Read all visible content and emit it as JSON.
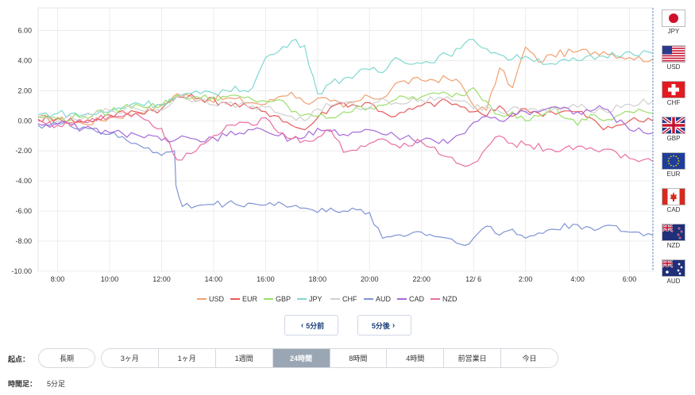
{
  "chart_data": {
    "type": "line",
    "y_ticks": [
      "6.00",
      "4.00",
      "2.00",
      "0.00",
      "-2.00",
      "-4.00",
      "-6.00",
      "-8.00",
      "-10.00"
    ],
    "ylim": [
      -10,
      7.5
    ],
    "x_ticks": [
      "8:00",
      "10:00",
      "12:00",
      "14:00",
      "16:00",
      "18:00",
      "20:00",
      "22:00",
      "12/ 6",
      "2:00",
      "4:00",
      "6:00"
    ],
    "x_tick_hours": [
      8,
      10,
      12,
      14,
      16,
      18,
      20,
      22,
      24,
      26,
      28,
      30
    ],
    "xlim": [
      7.25,
      30.9
    ],
    "grid": true,
    "legend_position": "bottom",
    "series": [
      {
        "name": "USD",
        "color": "#f0a070",
        "points": [
          [
            7.25,
            0.2
          ],
          [
            8,
            0.1
          ],
          [
            9,
            -0.2
          ],
          [
            10,
            0.2
          ],
          [
            11,
            0.5
          ],
          [
            12,
            1.0
          ],
          [
            12.6,
            1.8
          ],
          [
            13.5,
            1.4
          ],
          [
            14.5,
            1.5
          ],
          [
            15.5,
            1.2
          ],
          [
            16,
            1.1
          ],
          [
            16.5,
            1.6
          ],
          [
            17,
            1.9
          ],
          [
            17.5,
            1.2
          ],
          [
            18,
            1.5
          ],
          [
            18.5,
            1.3
          ],
          [
            19,
            0.9
          ],
          [
            20,
            1.6
          ],
          [
            20.5,
            1.5
          ],
          [
            21,
            2.5
          ],
          [
            22,
            2.7
          ],
          [
            23,
            2.8
          ],
          [
            23.5,
            2.5
          ],
          [
            24,
            1.0
          ],
          [
            24.5,
            0.7
          ],
          [
            25,
            3.5
          ],
          [
            25.5,
            2.2
          ],
          [
            26,
            4.9
          ],
          [
            26.5,
            3.9
          ],
          [
            27,
            4.4
          ],
          [
            28,
            4.6
          ],
          [
            29,
            4.6
          ],
          [
            30,
            4.2
          ],
          [
            30.9,
            4.1
          ]
        ]
      },
      {
        "name": "EUR",
        "color": "#e85a5a",
        "points": [
          [
            7.25,
            0.1
          ],
          [
            8,
            0.2
          ],
          [
            9,
            -0.1
          ],
          [
            10,
            0.4
          ],
          [
            11,
            0.6
          ],
          [
            12,
            0.8
          ],
          [
            12.6,
            1.6
          ],
          [
            13.5,
            1.5
          ],
          [
            14.5,
            1.2
          ],
          [
            15.5,
            0.8
          ],
          [
            16,
            0.6
          ],
          [
            16.5,
            0.3
          ],
          [
            17,
            -0.3
          ],
          [
            17.5,
            -0.6
          ],
          [
            18,
            0.2
          ],
          [
            18.5,
            0.9
          ],
          [
            19,
            1.2
          ],
          [
            19.5,
            1.0
          ],
          [
            20,
            1.2
          ],
          [
            20.5,
            0.6
          ],
          [
            21,
            0.3
          ],
          [
            22,
            1.0
          ],
          [
            23,
            1.3
          ],
          [
            24,
            0.6
          ],
          [
            24.5,
            0.3
          ],
          [
            25,
            1.0
          ],
          [
            25.5,
            0.3
          ],
          [
            26,
            0.8
          ],
          [
            26.5,
            0.5
          ],
          [
            27,
            0.6
          ],
          [
            28,
            0.6
          ],
          [
            28.5,
            0.2
          ],
          [
            29,
            -0.6
          ],
          [
            29.5,
            -0.3
          ],
          [
            30,
            0.0
          ],
          [
            30.9,
            0.0
          ]
        ]
      },
      {
        "name": "GBP",
        "color": "#9be06b",
        "points": [
          [
            7.25,
            0.3
          ],
          [
            8,
            0.1
          ],
          [
            9,
            0.3
          ],
          [
            10,
            0.6
          ],
          [
            11,
            1.1
          ],
          [
            12,
            1.0
          ],
          [
            12.6,
            1.7
          ],
          [
            13.5,
            1.5
          ],
          [
            14.5,
            1.6
          ],
          [
            15.5,
            1.4
          ],
          [
            16,
            1.3
          ],
          [
            16.5,
            1.4
          ],
          [
            17,
            0.6
          ],
          [
            17.5,
            0.4
          ],
          [
            18,
            0.3
          ],
          [
            18.5,
            0.2
          ],
          [
            19,
            0.6
          ],
          [
            20,
            0.9
          ],
          [
            21,
            1.4
          ],
          [
            22,
            1.6
          ],
          [
            23,
            1.8
          ],
          [
            23.5,
            1.7
          ],
          [
            24,
            2.2
          ],
          [
            24.5,
            1.3
          ],
          [
            25,
            0.4
          ],
          [
            25.5,
            0.6
          ],
          [
            26,
            0.0
          ],
          [
            26.5,
            0.3
          ],
          [
            27,
            0.9
          ],
          [
            28,
            -0.3
          ],
          [
            28.5,
            0.4
          ],
          [
            29,
            0.0
          ],
          [
            30,
            0.6
          ],
          [
            30.9,
            0.5
          ]
        ]
      },
      {
        "name": "JPY",
        "color": "#7fd8d0",
        "points": [
          [
            7.25,
            0.4
          ],
          [
            8,
            0.5
          ],
          [
            9,
            0.4
          ],
          [
            10,
            0.6
          ],
          [
            11,
            1.2
          ],
          [
            12,
            1.1
          ],
          [
            12.6,
            1.6
          ],
          [
            13.5,
            1.8
          ],
          [
            14.5,
            2.0
          ],
          [
            15.5,
            2.2
          ],
          [
            16,
            4.2
          ],
          [
            16.5,
            4.6
          ],
          [
            17,
            5.3
          ],
          [
            17.5,
            5.0
          ],
          [
            18,
            1.8
          ],
          [
            18.5,
            2.5
          ],
          [
            19,
            2.8
          ],
          [
            20,
            3.4
          ],
          [
            20.5,
            3.2
          ],
          [
            21,
            4.2
          ],
          [
            22,
            3.8
          ],
          [
            23,
            4.4
          ],
          [
            23.5,
            4.8
          ],
          [
            24,
            5.4
          ],
          [
            24.5,
            4.8
          ],
          [
            25,
            4.4
          ],
          [
            25.5,
            4.1
          ],
          [
            26,
            4.3
          ],
          [
            27,
            3.8
          ],
          [
            28,
            4.0
          ],
          [
            29,
            4.3
          ],
          [
            30,
            4.6
          ],
          [
            30.9,
            4.5
          ]
        ]
      },
      {
        "name": "CHF",
        "color": "#d0d0d0",
        "points": [
          [
            7.25,
            0.2
          ],
          [
            8,
            0.0
          ],
          [
            9,
            0.2
          ],
          [
            10,
            0.7
          ],
          [
            11,
            0.8
          ],
          [
            12,
            0.7
          ],
          [
            12.6,
            1.6
          ],
          [
            13.5,
            1.4
          ],
          [
            14.5,
            1.1
          ],
          [
            15.5,
            1.0
          ],
          [
            16,
            0.9
          ],
          [
            16.5,
            0.5
          ],
          [
            17,
            0.3
          ],
          [
            17.5,
            0.0
          ],
          [
            18,
            0.8
          ],
          [
            18.5,
            1.0
          ],
          [
            19,
            1.2
          ],
          [
            20,
            0.8
          ],
          [
            20.5,
            1.5
          ],
          [
            21,
            1.2
          ],
          [
            22,
            1.4
          ],
          [
            23,
            1.6
          ],
          [
            23.5,
            1.3
          ],
          [
            24,
            0.8
          ],
          [
            24.5,
            1.0
          ],
          [
            25,
            0.6
          ],
          [
            25.5,
            0.9
          ],
          [
            26,
            0.6
          ],
          [
            27,
            0.7
          ],
          [
            28,
            0.9
          ],
          [
            29,
            0.7
          ],
          [
            30,
            1.1
          ],
          [
            30.9,
            1.3
          ]
        ]
      },
      {
        "name": "AUD",
        "color": "#7f94d6",
        "points": [
          [
            7.25,
            -0.3
          ],
          [
            8,
            -0.2
          ],
          [
            9,
            -0.4
          ],
          [
            10,
            -0.9
          ],
          [
            11,
            -1.5
          ],
          [
            11.5,
            -1.8
          ],
          [
            12,
            -2.3
          ],
          [
            12.5,
            -2.0
          ],
          [
            12.55,
            -4.3
          ],
          [
            12.8,
            -5.7
          ],
          [
            13.5,
            -5.6
          ],
          [
            14.5,
            -5.5
          ],
          [
            15.5,
            -5.5
          ],
          [
            16,
            -5.6
          ],
          [
            16.5,
            -5.4
          ],
          [
            17,
            -5.7
          ],
          [
            17.5,
            -5.8
          ],
          [
            18,
            -6.1
          ],
          [
            18.5,
            -5.8
          ],
          [
            19,
            -6.0
          ],
          [
            20,
            -6.1
          ],
          [
            20.5,
            -7.8
          ],
          [
            21,
            -7.6
          ],
          [
            22,
            -7.4
          ],
          [
            23,
            -7.8
          ],
          [
            23.5,
            -8.2
          ],
          [
            24,
            -7.8
          ],
          [
            24.5,
            -7.0
          ],
          [
            25,
            -7.6
          ],
          [
            25.5,
            -7.2
          ],
          [
            26,
            -7.8
          ],
          [
            27,
            -7.2
          ],
          [
            28,
            -6.9
          ],
          [
            28.5,
            -7.1
          ],
          [
            29,
            -7.0
          ],
          [
            30,
            -7.4
          ],
          [
            30.9,
            -7.6
          ]
        ]
      },
      {
        "name": "CAD",
        "color": "#a66ad8",
        "points": [
          [
            7.25,
            -0.2
          ],
          [
            8,
            -0.2
          ],
          [
            9,
            -0.5
          ],
          [
            10,
            -0.8
          ],
          [
            11,
            -0.9
          ],
          [
            12,
            -1.3
          ],
          [
            12.6,
            -1.2
          ],
          [
            13.5,
            -1.4
          ],
          [
            14.5,
            -1.0
          ],
          [
            15.5,
            -0.6
          ],
          [
            16,
            -0.7
          ],
          [
            16.5,
            -1.0
          ],
          [
            17,
            -1.2
          ],
          [
            17.5,
            -1.1
          ],
          [
            18,
            -0.5
          ],
          [
            18.5,
            -0.7
          ],
          [
            19,
            -0.9
          ],
          [
            20,
            -0.6
          ],
          [
            20.5,
            -0.9
          ],
          [
            21,
            -1.0
          ],
          [
            22,
            -1.3
          ],
          [
            23,
            -1.5
          ],
          [
            23.5,
            -0.9
          ],
          [
            24,
            -0.1
          ],
          [
            24.5,
            0.3
          ],
          [
            25,
            0.0
          ],
          [
            25.5,
            0.5
          ],
          [
            26,
            0.6
          ],
          [
            27,
            0.9
          ],
          [
            28,
            0.6
          ],
          [
            29,
            0.8
          ],
          [
            30,
            -0.6
          ],
          [
            30.9,
            -0.8
          ]
        ]
      },
      {
        "name": "NZD",
        "color": "#ea6fa3",
        "points": [
          [
            7.25,
            0.0
          ],
          [
            8,
            -0.3
          ],
          [
            9,
            -0.1
          ],
          [
            10,
            0.3
          ],
          [
            11,
            0.5
          ],
          [
            12,
            -0.5
          ],
          [
            12.6,
            -2.6
          ],
          [
            13.5,
            -1.6
          ],
          [
            14.5,
            -0.3
          ],
          [
            15.5,
            -0.3
          ],
          [
            16,
            0.2
          ],
          [
            16.5,
            -0.8
          ],
          [
            17,
            -1.2
          ],
          [
            17.5,
            -1.3
          ],
          [
            18,
            -1.1
          ],
          [
            18.5,
            -0.6
          ],
          [
            19,
            -2.1
          ],
          [
            20,
            -1.5
          ],
          [
            20.5,
            -1.2
          ],
          [
            21,
            -1.6
          ],
          [
            22,
            -1.4
          ],
          [
            23,
            -2.4
          ],
          [
            23.5,
            -2.9
          ],
          [
            24,
            -2.8
          ],
          [
            24.5,
            -1.8
          ],
          [
            25,
            -1.0
          ],
          [
            25.5,
            -1.5
          ],
          [
            26,
            -1.6
          ],
          [
            27,
            -1.9
          ],
          [
            28,
            -1.7
          ],
          [
            29,
            -1.9
          ],
          [
            30,
            -2.5
          ],
          [
            30.9,
            -2.7
          ]
        ]
      }
    ]
  },
  "flags": [
    {
      "code": "JPY",
      "label": "JPY"
    },
    {
      "code": "USD",
      "label": "USD"
    },
    {
      "code": "CHF",
      "label": "CHF"
    },
    {
      "code": "GBP",
      "label": "GBP"
    },
    {
      "code": "EUR",
      "label": "EUR"
    },
    {
      "code": "CAD",
      "label": "CAD"
    },
    {
      "code": "NZD",
      "label": "NZD"
    },
    {
      "code": "AUD",
      "label": "AUD"
    }
  ],
  "nav": {
    "prev_label": "5分前",
    "next_label": "5分後",
    "prev_icon": "chevron-left-icon",
    "next_icon": "chevron-right-icon"
  },
  "start_point": {
    "label": "起点：",
    "long_term_label": "長期",
    "options": [
      "3ヶ月",
      "1ヶ月",
      "1週間",
      "24時間",
      "8時間",
      "4時間",
      "前営業日",
      "今日"
    ],
    "selected": "24時間"
  },
  "interval": {
    "label": "時間足：",
    "value": "5分足"
  }
}
